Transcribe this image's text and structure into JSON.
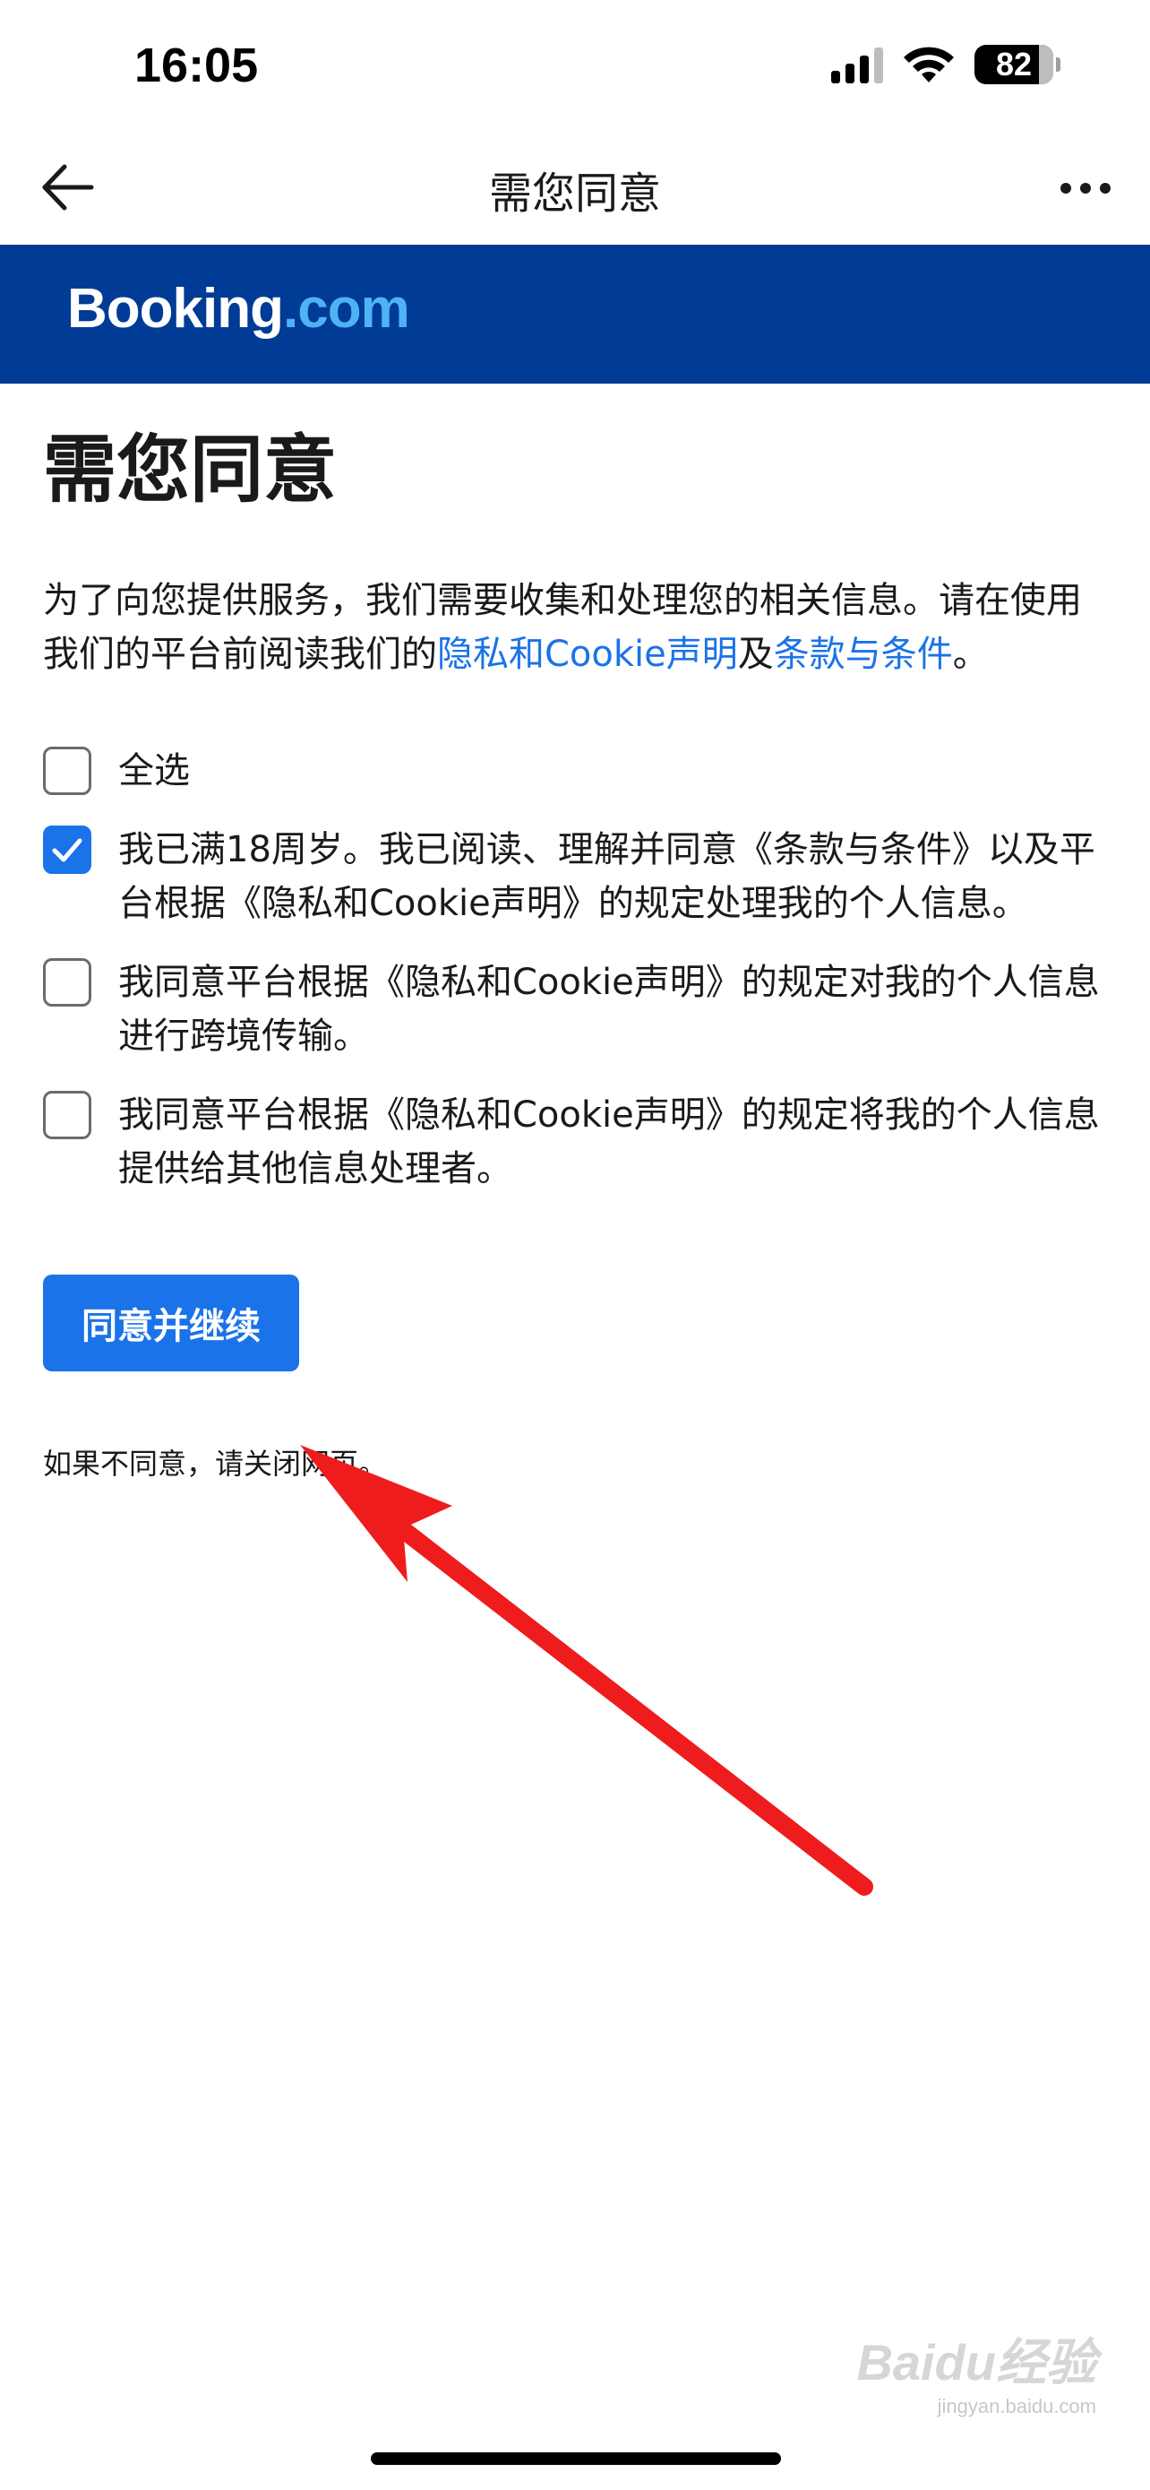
{
  "status_bar": {
    "time": "16:05",
    "battery": "82"
  },
  "nav": {
    "title": "需您同意",
    "back_icon": "arrow-left-icon",
    "more_icon": "more-horizontal-icon"
  },
  "brand": {
    "logo_main": "Booking",
    "logo_suffix": ".com",
    "bg_color": "#003b95",
    "suffix_color": "#4fb2f5"
  },
  "main": {
    "heading": "需您同意",
    "intro_before": "为了向您提供服务，我们需要收集和处理您的相关信息。请在使用我们的平台前阅读我们的",
    "privacy_link": "隐私和Cookie声明",
    "intro_and": "及",
    "terms_link": "条款与条件",
    "intro_end": "。",
    "options": [
      {
        "label": "全选",
        "checked": false
      },
      {
        "label": "我已满18周岁。我已阅读、理解并同意《条款与条件》以及平台根据《隐私和Cookie声明》的规定处理我的个人信息。",
        "checked": true
      },
      {
        "label": "我同意平台根据《隐私和Cookie声明》的规定对我的个人信息进行跨境传输。",
        "checked": false
      },
      {
        "label": "我同意平台根据《隐私和Cookie声明》的规定将我的个人信息提供给其他信息处理者。",
        "checked": false
      }
    ],
    "continue_label": "同意并继续",
    "disagree_note": "如果不同意，请关闭网页。"
  },
  "colors": {
    "accent": "#1a73e8",
    "annotation": "#ee1c1c"
  },
  "watermark": {
    "main": "Baidu经验",
    "sub": "jingyan.baidu.com"
  }
}
